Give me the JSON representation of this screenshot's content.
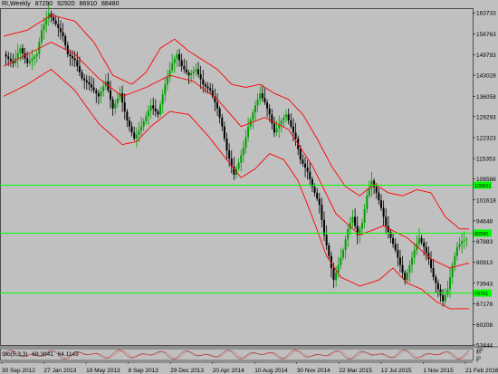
{
  "window": {
    "symbol": "RI,Weekly",
    "ohlc": [
      "87290",
      "92920",
      "86910",
      "88480"
    ]
  },
  "subwindow": {
    "label": "Sto(5,3,3)",
    "values": [
      "69.3841",
      "64.1143"
    ],
    "levels": [
      "100",
      "80",
      "20",
      "0"
    ]
  },
  "colors": {
    "background": "#c0c0c0",
    "bull": "#00a000",
    "bear": "#000000",
    "bands": "#ff0000",
    "level_lines": "#00ff00",
    "grid": "#a8a8a8"
  },
  "chart_data": {
    "type": "candlestick",
    "title": "",
    "symbol": "RI",
    "timeframe": "Weekly",
    "x_tick_labels": [
      "30 Sep 2012",
      "27 Jan 2013",
      "19 May 2013",
      "8 Sep 2013",
      "29 Dec 2013",
      "20 Apr 2014",
      "10 Aug 2014",
      "30 Nov 2014",
      "22 Mar 2015",
      "12 Jul 2015",
      "1 Nov 2015",
      "21 Feb 2016"
    ],
    "y_tick_labels": [
      "163733",
      "156763",
      "149793",
      "143028",
      "136058",
      "129293",
      "122323",
      "115353",
      "108588",
      "101618",
      "94648",
      "87883",
      "80913",
      "73943",
      "67178",
      "60208",
      "53444"
    ],
    "ylim": [
      53444,
      165000
    ],
    "horizontal_levels": [
      {
        "value": 106531,
        "label": "106531"
      },
      {
        "value": 90590,
        "label": "90590"
      },
      {
        "value": 70701,
        "label": "70701"
      }
    ],
    "indicators": [
      "Bollinger Bands (upper, middle, lower)",
      "Stochastic Oscillator (5,3,3)"
    ],
    "stochastic_last": [
      69.3841,
      64.1143
    ],
    "price_path": [
      [
        0,
        150000
      ],
      [
        4,
        147000
      ],
      [
        7,
        152000
      ],
      [
        10,
        147000
      ],
      [
        14,
        150000
      ],
      [
        16,
        158000
      ],
      [
        19,
        163500
      ],
      [
        22,
        160000
      ],
      [
        25,
        156000
      ],
      [
        27,
        150000
      ],
      [
        30,
        148000
      ],
      [
        33,
        142000
      ],
      [
        36,
        140000
      ],
      [
        40,
        136000
      ],
      [
        43,
        141000
      ],
      [
        46,
        132000
      ],
      [
        49,
        137000
      ],
      [
        52,
        128000
      ],
      [
        55,
        122000
      ],
      [
        58,
        126000
      ],
      [
        62,
        133000
      ],
      [
        65,
        130000
      ],
      [
        68,
        140000
      ],
      [
        71,
        147000
      ],
      [
        73,
        150000
      ],
      [
        75,
        146000
      ],
      [
        78,
        143000
      ],
      [
        81,
        145000
      ],
      [
        84,
        140000
      ],
      [
        87,
        138000
      ],
      [
        90,
        132000
      ],
      [
        92,
        126000
      ],
      [
        94,
        118000
      ],
      [
        97,
        110000
      ],
      [
        99,
        114000
      ],
      [
        101,
        119000
      ],
      [
        103,
        126000
      ],
      [
        106,
        133000
      ],
      [
        108,
        137000
      ],
      [
        110,
        134000
      ],
      [
        112,
        130000
      ],
      [
        114,
        124000
      ],
      [
        117,
        128000
      ],
      [
        119,
        130000
      ],
      [
        121,
        126000
      ],
      [
        123,
        122000
      ],
      [
        125,
        115000
      ],
      [
        128,
        111000
      ],
      [
        130,
        106000
      ],
      [
        133,
        100000
      ],
      [
        135,
        90000
      ],
      [
        137,
        83000
      ],
      [
        139,
        75000
      ],
      [
        141,
        80000
      ],
      [
        143,
        85000
      ],
      [
        145,
        92000
      ],
      [
        147,
        96000
      ],
      [
        149,
        90000
      ],
      [
        151,
        94000
      ],
      [
        153,
        103000
      ],
      [
        155,
        108000
      ],
      [
        157,
        104000
      ],
      [
        159,
        99000
      ],
      [
        161,
        93000
      ],
      [
        163,
        89000
      ],
      [
        165,
        85000
      ],
      [
        167,
        80000
      ],
      [
        169,
        75000
      ],
      [
        171,
        80000
      ],
      [
        173,
        85000
      ],
      [
        175,
        89000
      ],
      [
        177,
        86000
      ],
      [
        179,
        82000
      ],
      [
        181,
        76000
      ],
      [
        183,
        72000
      ],
      [
        185,
        68000
      ],
      [
        187,
        72000
      ],
      [
        189,
        80000
      ],
      [
        191,
        86000
      ],
      [
        193,
        88000
      ],
      [
        195,
        88480
      ]
    ],
    "bb_upper": [
      [
        0,
        156000
      ],
      [
        10,
        158000
      ],
      [
        20,
        163000
      ],
      [
        30,
        161000
      ],
      [
        38,
        154000
      ],
      [
        46,
        143000
      ],
      [
        54,
        140000
      ],
      [
        60,
        144000
      ],
      [
        66,
        152000
      ],
      [
        72,
        155000
      ],
      [
        78,
        151000
      ],
      [
        84,
        148000
      ],
      [
        90,
        145000
      ],
      [
        96,
        140000
      ],
      [
        102,
        139000
      ],
      [
        108,
        140000
      ],
      [
        114,
        137000
      ],
      [
        120,
        135000
      ],
      [
        126,
        130000
      ],
      [
        132,
        122000
      ],
      [
        138,
        113000
      ],
      [
        144,
        106000
      ],
      [
        150,
        103000
      ],
      [
        156,
        107000
      ],
      [
        162,
        104000
      ],
      [
        168,
        103000
      ],
      [
        174,
        105000
      ],
      [
        180,
        104000
      ],
      [
        186,
        96000
      ],
      [
        192,
        92000
      ],
      [
        195,
        92000
      ]
    ],
    "bb_middle": [
      [
        0,
        146000
      ],
      [
        10,
        150000
      ],
      [
        20,
        154000
      ],
      [
        30,
        150000
      ],
      [
        40,
        142000
      ],
      [
        50,
        136000
      ],
      [
        60,
        139000
      ],
      [
        70,
        143000
      ],
      [
        80,
        141000
      ],
      [
        90,
        135000
      ],
      [
        100,
        126000
      ],
      [
        110,
        129000
      ],
      [
        120,
        125000
      ],
      [
        130,
        113000
      ],
      [
        140,
        97000
      ],
      [
        150,
        90000
      ],
      [
        160,
        93000
      ],
      [
        170,
        89000
      ],
      [
        180,
        82000
      ],
      [
        188,
        79000
      ],
      [
        195,
        80500
      ]
    ],
    "bb_lower": [
      [
        0,
        136000
      ],
      [
        10,
        140000
      ],
      [
        20,
        145000
      ],
      [
        30,
        138000
      ],
      [
        40,
        127000
      ],
      [
        50,
        120000
      ],
      [
        56,
        121000
      ],
      [
        62,
        126000
      ],
      [
        70,
        131000
      ],
      [
        78,
        130000
      ],
      [
        86,
        123000
      ],
      [
        94,
        115000
      ],
      [
        100,
        109000
      ],
      [
        106,
        112000
      ],
      [
        112,
        117000
      ],
      [
        118,
        115000
      ],
      [
        124,
        108000
      ],
      [
        130,
        96000
      ],
      [
        136,
        83000
      ],
      [
        142,
        76000
      ],
      [
        150,
        73000
      ],
      [
        158,
        75000
      ],
      [
        164,
        79000
      ],
      [
        170,
        74000
      ],
      [
        176,
        72000
      ],
      [
        182,
        68000
      ],
      [
        188,
        65500
      ],
      [
        195,
        65500
      ]
    ]
  }
}
